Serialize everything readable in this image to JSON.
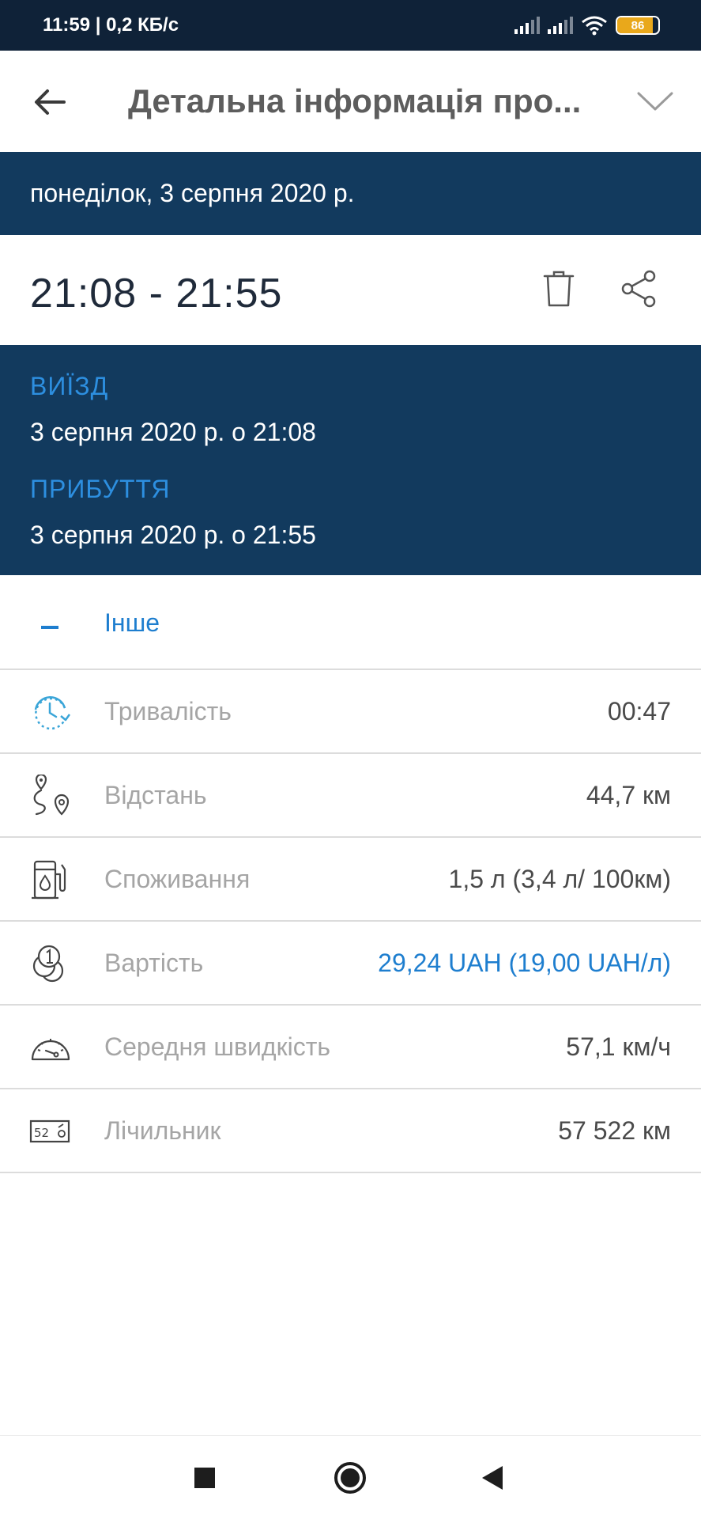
{
  "status_bar": {
    "time_speed": "11:59 | 0,2 КБ/с",
    "battery_level": "86",
    "battery_fraction": 0.86
  },
  "header": {
    "title": "Детальна інформація про...",
    "back_icon": "arrow-left-icon",
    "expand_icon": "chevron-down-icon"
  },
  "date_banner": {
    "text": "понеділок, 3 серпня 2020 р."
  },
  "trip": {
    "time_range": "21:08 - 21:55",
    "departure_label": "ВИЇЗД",
    "departure_value": "3 серпня 2020 р. о 21:08",
    "arrival_label": "ПРИБУТТЯ",
    "arrival_value": "3 серпня 2020 р. о 21:55"
  },
  "section": {
    "label": "Інше"
  },
  "details": [
    {
      "icon": "clock-icon",
      "label": "Тривалість",
      "value": "00:47"
    },
    {
      "icon": "route-icon",
      "label": "Відстань",
      "value": "44,7 км"
    },
    {
      "icon": "fuel-pump-icon",
      "label": "Споживання",
      "value": "1,5 л (3,4 л/ 100км)"
    },
    {
      "icon": "coins-icon",
      "label": "Вартість",
      "value": "29,24 UAH (19,00 UAH/л)"
    },
    {
      "icon": "speedometer-icon",
      "label": "Середня швидкість",
      "value": "57,1 км/ч"
    },
    {
      "icon": "odometer-icon",
      "label": "Лічильник",
      "value": "57 522 км"
    }
  ],
  "colors": {
    "primary_dark": "#123a5e",
    "status_bar": "#0f2238",
    "accent": "#1e7ecf",
    "label_blue": "#2d8fe0"
  }
}
